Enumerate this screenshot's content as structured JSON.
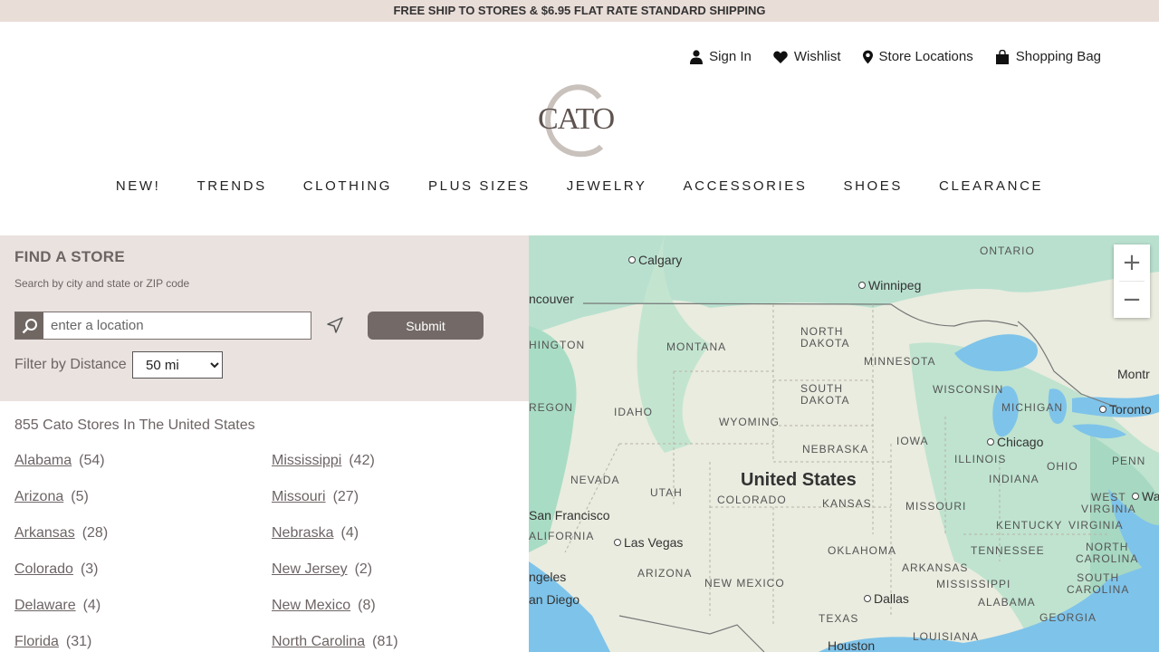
{
  "promo": "FREE SHIP TO STORES & $6.95 FLAT RATE STANDARD SHIPPING",
  "util": {
    "sign_in": "Sign In",
    "wishlist": "Wishlist",
    "store_locations": "Store Locations",
    "shopping_bag": "Shopping Bag"
  },
  "logo_text": "CATO",
  "nav": [
    "NEW!",
    "TRENDS",
    "CLOTHING",
    "PLUS SIZES",
    "JEWELRY",
    "ACCESSORIES",
    "SHOES",
    "CLEARANCE"
  ],
  "finder": {
    "title": "FIND A STORE",
    "subtitle": "Search by city and state or ZIP code",
    "placeholder": "enter a location",
    "submit": "Submit",
    "filter_label": "Filter by Distance",
    "distance": "50 mi"
  },
  "count": "855 Cato Stores In The United States",
  "states_left": [
    {
      "name": "Alabama",
      "count": "(54)"
    },
    {
      "name": "Arizona",
      "count": "(5)"
    },
    {
      "name": "Arkansas",
      "count": "(28)"
    },
    {
      "name": "Colorado",
      "count": "(3)"
    },
    {
      "name": "Delaware",
      "count": "(4)"
    },
    {
      "name": "Florida",
      "count": "(31)"
    }
  ],
  "states_right": [
    {
      "name": "Mississippi",
      "count": "(42)"
    },
    {
      "name": "Missouri",
      "count": "(27)"
    },
    {
      "name": "Nebraska",
      "count": "(4)"
    },
    {
      "name": "New Jersey",
      "count": "(2)"
    },
    {
      "name": "New Mexico",
      "count": "(8)"
    },
    {
      "name": "North Carolina",
      "count": "(81)"
    }
  ],
  "map": {
    "country": "United States",
    "zoom_in": "+",
    "zoom_out": "−",
    "states": [
      "ONTARIO",
      "NORTH DAKOTA",
      "MONTANA",
      "MINNESOTA",
      "SOUTH DAKOTA",
      "WISCONSIN",
      "MICHIGAN",
      "IDAHO",
      "WYOMING",
      "NEBRASKA",
      "IOWA",
      "ILLINOIS",
      "INDIANA",
      "OHIO",
      "PENN",
      "NEVADA",
      "UTAH",
      "COLORADO",
      "KANSAS",
      "MISSOURI",
      "WEST VIRGINIA",
      "KENTUCKY",
      "VIRGINIA",
      "TENNESSEE",
      "NORTH CAROLINA",
      "OKLAHOMA",
      "ARKANSAS",
      "MISSISSIPPI",
      "SOUTH CAROLINA",
      "ALABAMA",
      "GEORGIA",
      "ARIZONA",
      "NEW MEXICO",
      "TEXAS",
      "LOUISIANA",
      "ALIFORNIA",
      "HINGTON",
      "REGON"
    ],
    "cities": [
      "Calgary",
      "Winnipeg",
      "ncouver",
      "Chicago",
      "Toronto",
      "Montr",
      "Wa",
      "San Francisco",
      "Las Vegas",
      "ngeles",
      "an Diego",
      "Dallas",
      "Houston"
    ]
  }
}
